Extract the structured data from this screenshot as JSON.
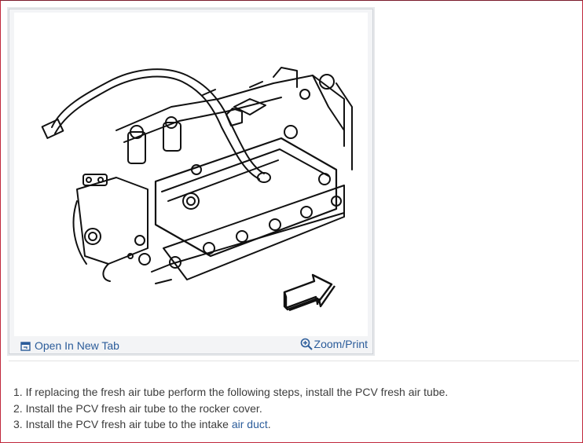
{
  "figure": {
    "alt": "PCV fresh air tube installation diagram",
    "open_tab_label": "Open In New Tab",
    "open_tab_icon": "open-in-new-tab-icon",
    "zoom_label": "Zoom/Print",
    "zoom_icon": "zoom-in-icon",
    "link_color": "#2b5c9a"
  },
  "steps": [
    {
      "prefix": "1. If replacing the fresh air tube perform the following steps, install the PCV fresh air tube.",
      "link": "",
      "suffix": ""
    },
    {
      "prefix": "2. Install the PCV fresh air tube to the rocker cover.",
      "link": "",
      "suffix": ""
    },
    {
      "prefix": "3. Install the PCV fresh air tube to the intake ",
      "link": "air duct",
      "suffix": "."
    }
  ]
}
